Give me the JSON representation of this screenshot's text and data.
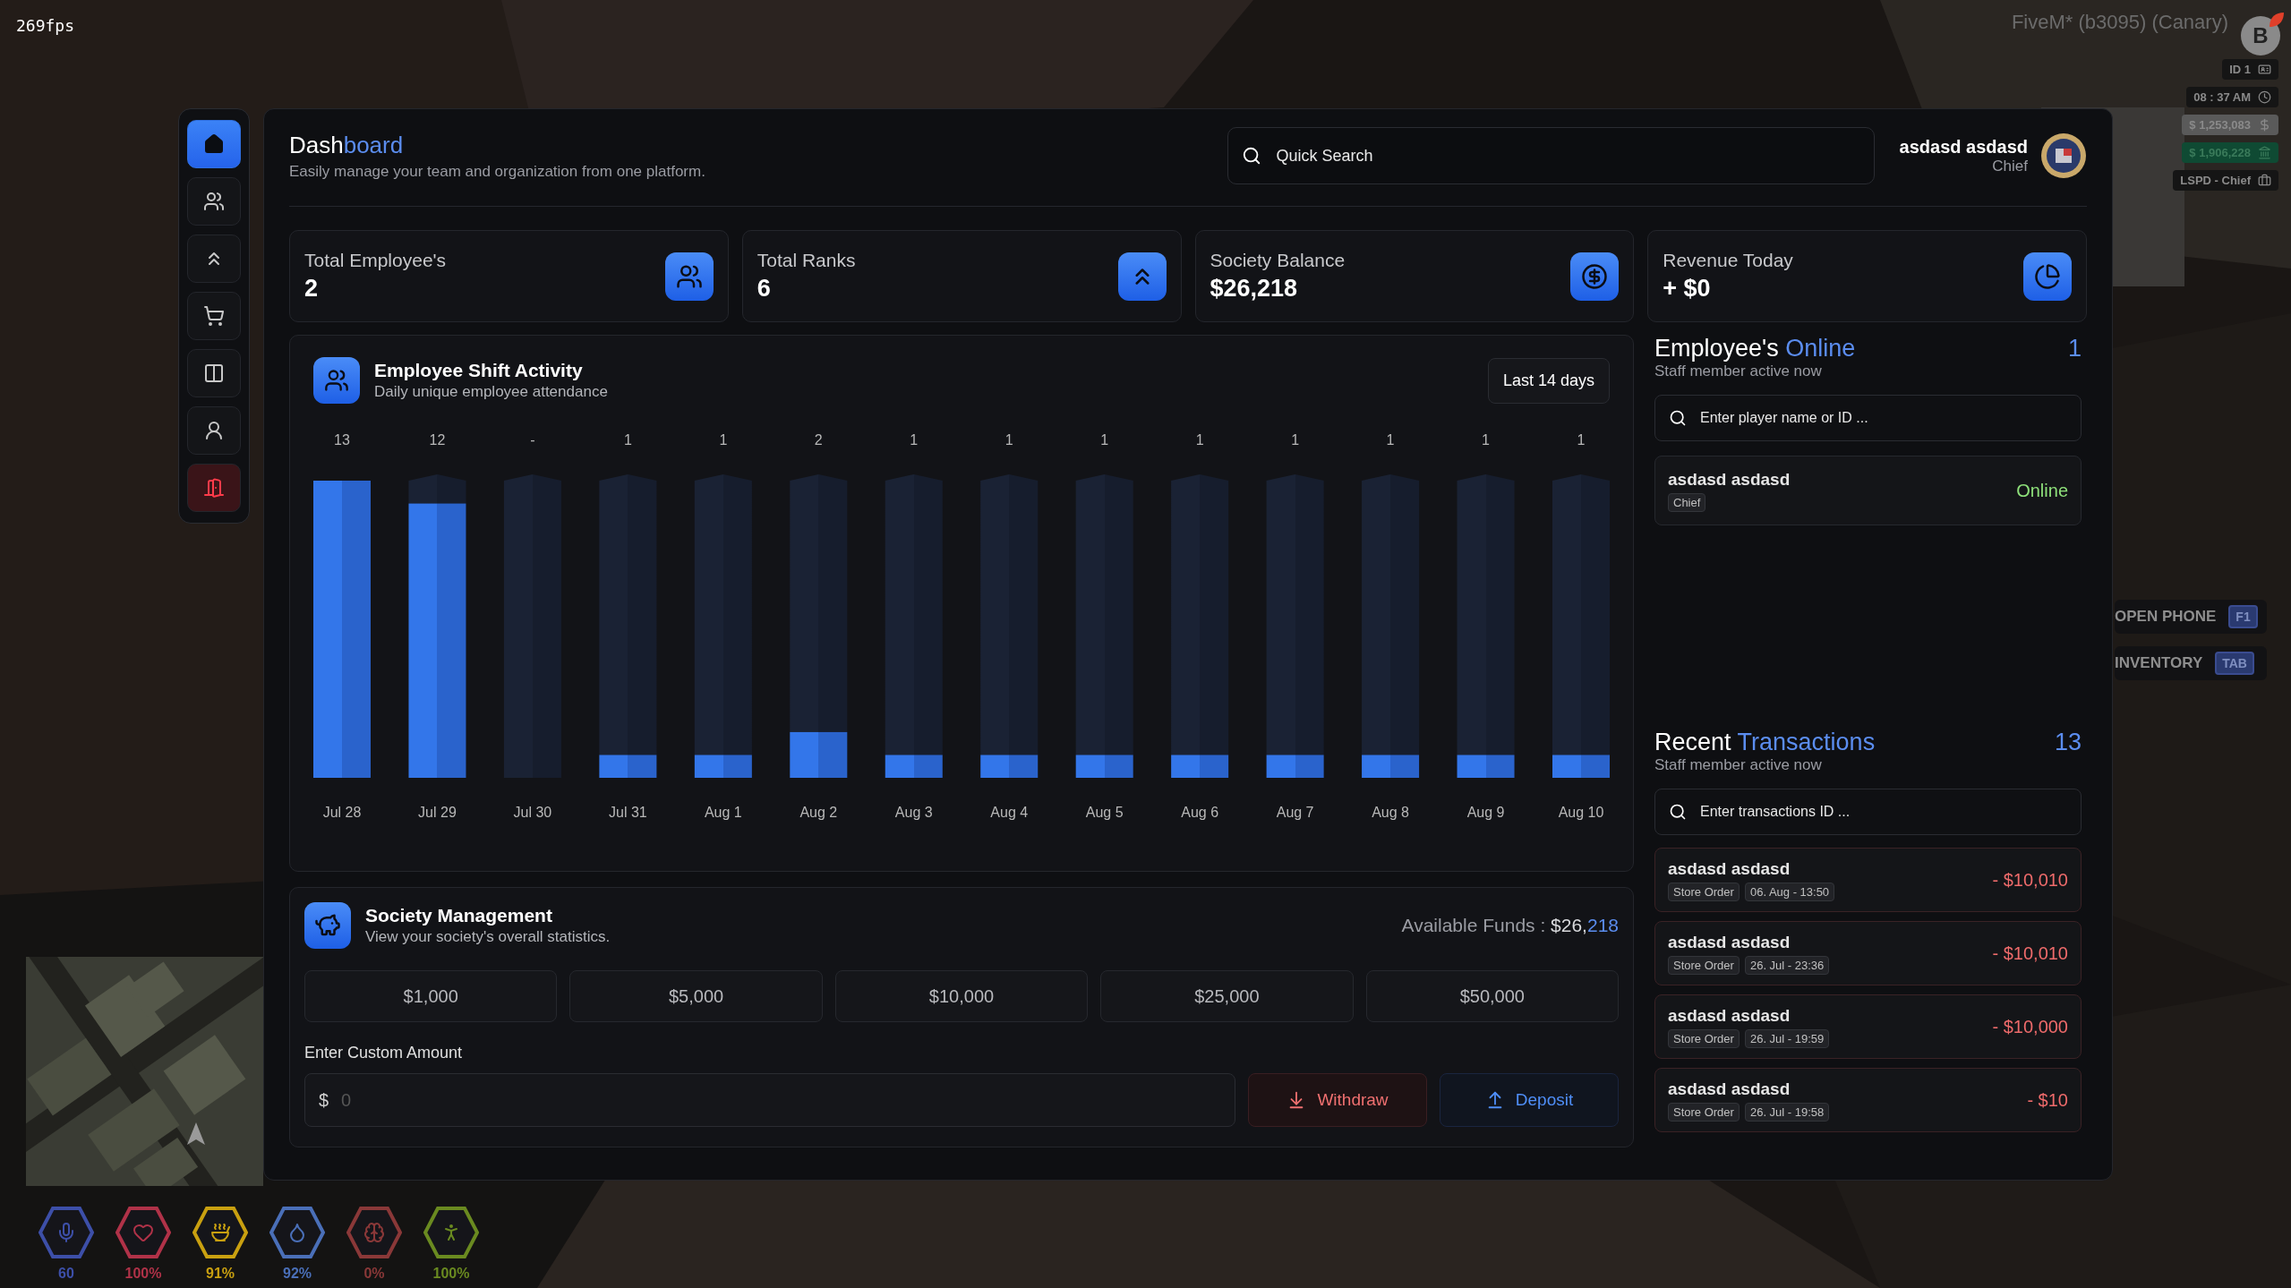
{
  "hud": {
    "fps": "269fps",
    "build": "FiveM* (b3095) (Canary)",
    "logo": "B",
    "badges": [
      {
        "kind": "id",
        "text": "ID 1"
      },
      {
        "kind": "time",
        "text": "08 : 37 AM"
      },
      {
        "kind": "cash",
        "text": "$ 1,253,083"
      },
      {
        "kind": "bank",
        "text": "$ 1,906,228"
      },
      {
        "kind": "job",
        "text": "LSPD - Chief"
      }
    ],
    "keybinds": [
      {
        "label": "OPEN PHONE",
        "key": "F1"
      },
      {
        "label": "INVENTORY",
        "key": "TAB"
      }
    ],
    "status": [
      {
        "kind": "voice",
        "value": "60",
        "color": "#3d4fa8"
      },
      {
        "kind": "health",
        "value": "100%",
        "color": "#b03248"
      },
      {
        "kind": "food",
        "value": "91%",
        "color": "#c9a010"
      },
      {
        "kind": "water",
        "value": "92%",
        "color": "#4a6fb8"
      },
      {
        "kind": "stress",
        "value": "0%",
        "color": "#8a3838"
      },
      {
        "kind": "stamina",
        "value": "100%",
        "color": "#6a8a20"
      }
    ]
  },
  "sidebar": {
    "items": [
      {
        "kind": "home",
        "selected": true
      },
      {
        "kind": "employees",
        "selected": false
      },
      {
        "kind": "ranks",
        "selected": false
      },
      {
        "kind": "store",
        "selected": false
      },
      {
        "kind": "lockers",
        "selected": false
      },
      {
        "kind": "profile",
        "selected": false
      },
      {
        "kind": "exit",
        "selected": false
      }
    ]
  },
  "header": {
    "title_lead": "Dash",
    "title_accent": "board",
    "subtitle": "Easily manage your team and organization from one platform.",
    "search_placeholder": "Quick Search",
    "user_name": "asdasd asdasd",
    "user_rank": "Chief"
  },
  "stats": [
    {
      "kind": "employees",
      "label": "Total Employee's",
      "value": "2"
    },
    {
      "kind": "ranks",
      "label": "Total Ranks",
      "value": "6"
    },
    {
      "kind": "balance",
      "label": "Society Balance",
      "value": "$26,218"
    },
    {
      "kind": "revenue",
      "label": "Revenue Today",
      "value": "+ $0"
    }
  ],
  "shift_activity": {
    "title": "Employee Shift Activity",
    "subtitle": "Daily unique employee attendance",
    "range": "Last 14 days",
    "chart_data": {
      "type": "bar",
      "categories": [
        "Jul 28",
        "Jul 29",
        "Jul 30",
        "Jul 31",
        "Aug 1",
        "Aug 2",
        "Aug 3",
        "Aug 4",
        "Aug 5",
        "Aug 6",
        "Aug 7",
        "Aug 8",
        "Aug 9",
        "Aug 10"
      ],
      "values": [
        13,
        12,
        null,
        1,
        1,
        2,
        1,
        1,
        1,
        1,
        1,
        1,
        1,
        1
      ],
      "value_labels": [
        "13",
        "12",
        "-",
        "1",
        "1",
        "2",
        "1",
        "1",
        "1",
        "1",
        "1",
        "1",
        "1",
        "1"
      ]
    }
  },
  "society": {
    "title": "Society Management",
    "subtitle": "View your society's overall statistics.",
    "funds_label": "Available Funds :",
    "funds_lead": "$26,",
    "funds_accent": "218",
    "presets": [
      "$1,000",
      "$5,000",
      "$10,000",
      "$25,000",
      "$50,000"
    ],
    "custom_label": "Enter Custom Amount",
    "currency": "$",
    "amount_placeholder": "0",
    "actions": [
      {
        "kind": "withdraw",
        "label": "Withdraw"
      },
      {
        "kind": "deposit",
        "label": "Deposit"
      }
    ]
  },
  "online": {
    "title_lead": "Employee's ",
    "title_accent": "Online",
    "count": "1",
    "subtitle": "Staff member active now",
    "search_placeholder": "Enter player name or ID ...",
    "employees": [
      {
        "name": "asdasd asdasd",
        "rank": "Chief",
        "status": "Online",
        "online": true
      }
    ]
  },
  "transactions": {
    "title_lead": "Recent ",
    "title_accent": "Transactions",
    "count": "13",
    "subtitle": "Staff member active now",
    "search_placeholder": "Enter transactions ID ...",
    "items": [
      {
        "name": "asdasd asdasd",
        "tags": [
          "Store Order",
          "06. Aug - 13:50"
        ],
        "amount": "- $10,010"
      },
      {
        "name": "asdasd asdasd",
        "tags": [
          "Store Order",
          "26. Jul - 23:36"
        ],
        "amount": "- $10,010"
      },
      {
        "name": "asdasd asdasd",
        "tags": [
          "Store Order",
          "26. Jul - 19:59"
        ],
        "amount": "- $10,000"
      },
      {
        "name": "asdasd asdasd",
        "tags": [
          "Store Order",
          "26. Jul - 19:58"
        ],
        "amount": "- $10"
      }
    ]
  }
}
